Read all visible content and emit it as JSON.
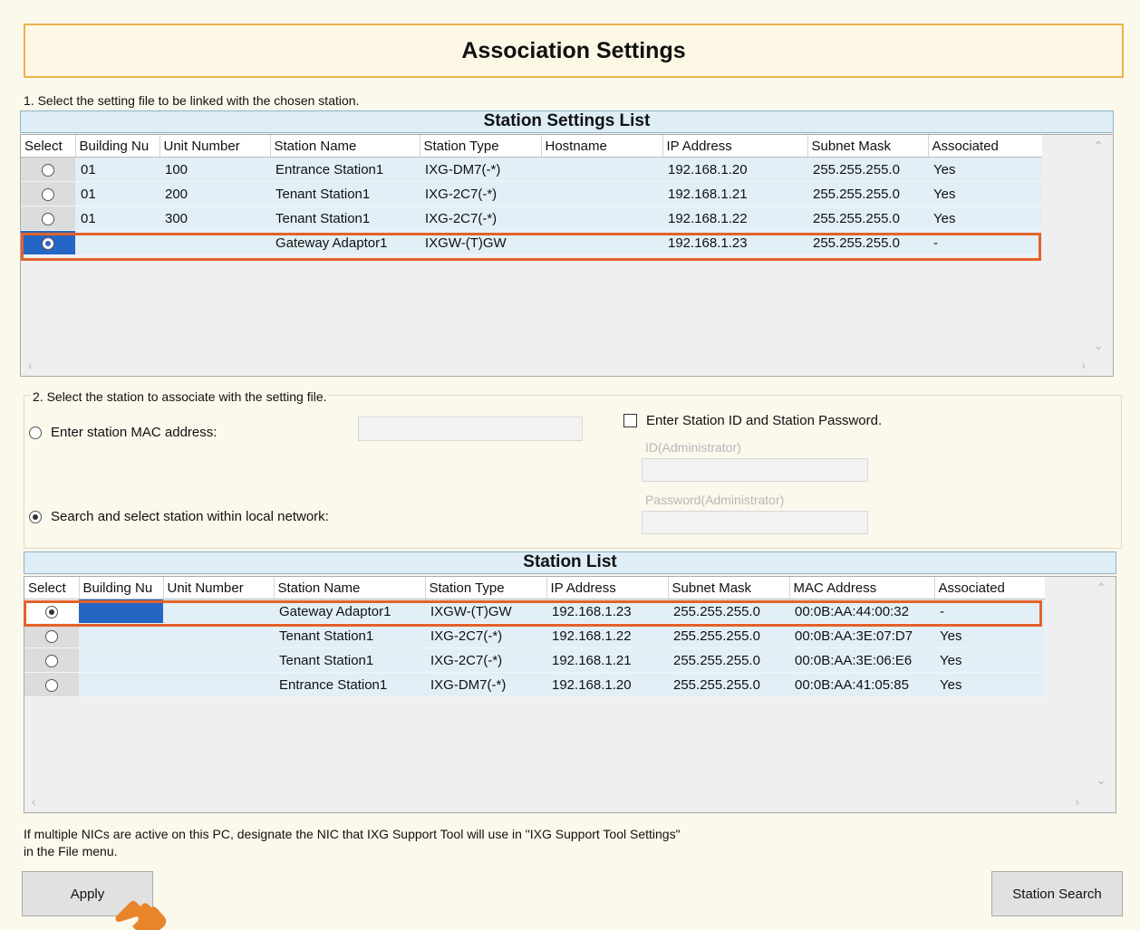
{
  "title": "Association Settings",
  "step1": {
    "instruction": "1. Select the setting file to be linked with the chosen station.",
    "list_title": "Station Settings List",
    "columns": [
      "Select",
      "Building Nu",
      "Unit Number",
      "Station Name",
      "Station Type",
      "Hostname",
      "IP Address",
      "Subnet Mask",
      "Associated"
    ],
    "rows": [
      {
        "building": "01",
        "unit": "100",
        "name": "Entrance Station1",
        "type": "IXG-DM7(-*)",
        "hostname": "",
        "ip": "192.168.1.20",
        "mask": "255.255.255.0",
        "associated": "Yes"
      },
      {
        "building": "01",
        "unit": "200",
        "name": "Tenant Station1",
        "type": "IXG-2C7(-*)",
        "hostname": "",
        "ip": "192.168.1.21",
        "mask": "255.255.255.0",
        "associated": "Yes"
      },
      {
        "building": "01",
        "unit": "300",
        "name": "Tenant Station1",
        "type": "IXG-2C7(-*)",
        "hostname": "",
        "ip": "192.168.1.22",
        "mask": "255.255.255.0",
        "associated": "Yes"
      },
      {
        "building": "",
        "unit": "",
        "name": "Gateway Adaptor1",
        "type": "IXGW-(T)GW",
        "hostname": "",
        "ip": "192.168.1.23",
        "mask": "255.255.255.0",
        "associated": "-"
      }
    ]
  },
  "step2": {
    "instruction": "2. Select the station to associate with the setting file.",
    "mac_option": "Enter station MAC address:",
    "search_option": "Search and select station within local network:",
    "id_checkbox": "Enter Station ID and  Station Password.",
    "id_label": "ID(Administrator)",
    "password_label": "Password(Administrator)",
    "list_title": "Station List",
    "columns": [
      "Select",
      "Building Nu",
      "Unit Number",
      "Station Name",
      "Station Type",
      "IP Address",
      "Subnet Mask",
      "MAC Address",
      "Associated"
    ],
    "rows": [
      {
        "building": "",
        "unit": "",
        "name": "Gateway Adaptor1",
        "type": "IXGW-(T)GW",
        "ip": "192.168.1.23",
        "mask": "255.255.255.0",
        "mac": "00:0B:AA:44:00:32",
        "associated": "-"
      },
      {
        "building": "",
        "unit": "",
        "name": "Tenant Station1",
        "type": "IXG-2C7(-*)",
        "ip": "192.168.1.22",
        "mask": "255.255.255.0",
        "mac": "00:0B:AA:3E:07:D7",
        "associated": "Yes"
      },
      {
        "building": "",
        "unit": "",
        "name": "Tenant Station1",
        "type": "IXG-2C7(-*)",
        "ip": "192.168.1.21",
        "mask": "255.255.255.0",
        "mac": "00:0B:AA:3E:06:E6",
        "associated": "Yes"
      },
      {
        "building": "",
        "unit": "",
        "name": "Entrance Station1",
        "type": "IXG-DM7(-*)",
        "ip": "192.168.1.20",
        "mask": "255.255.255.0",
        "mac": "00:0B:AA:41:05:85",
        "associated": "Yes"
      }
    ]
  },
  "note_line1": "If multiple NICs are active on this PC, designate the NIC that IXG Support Tool will use in \"IXG Support Tool Settings\"",
  "note_line2": "in the File menu.",
  "buttons": {
    "apply": "Apply",
    "station_search": "Station Search"
  },
  "colors": {
    "highlight": "#e2622a",
    "selection": "#2566c4",
    "title_border": "#f0b24a",
    "pointer_hand": "#e8852c"
  }
}
